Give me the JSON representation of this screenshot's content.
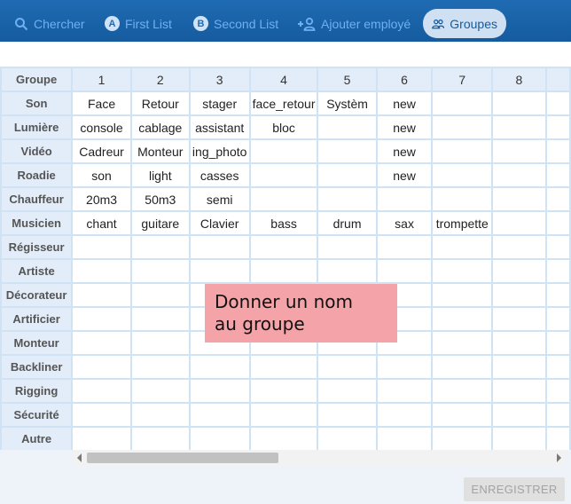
{
  "nav": {
    "chercher": "Chercher",
    "first_list": "First List",
    "first_list_badge": "A",
    "second_list": "Second List",
    "second_list_badge": "B",
    "ajouter": "Ajouter employé",
    "groupes": "Groupes"
  },
  "table": {
    "corner": "Groupe",
    "columns": [
      "1",
      "2",
      "3",
      "4",
      "5",
      "6",
      "7",
      "8"
    ],
    "rows": [
      {
        "label": "Son",
        "cells": [
          "Face",
          "Retour",
          "stager",
          "face_retour",
          "Systèm",
          "new",
          "",
          ""
        ]
      },
      {
        "label": "Lumière",
        "cells": [
          "console",
          "cablage",
          "assistant",
          "bloc",
          "",
          "new",
          "",
          ""
        ]
      },
      {
        "label": "Vidéo",
        "cells": [
          "Cadreur",
          "Monteur",
          "ing_photo",
          "",
          "",
          "new",
          "",
          ""
        ]
      },
      {
        "label": "Roadie",
        "cells": [
          "son",
          "light",
          "casses",
          "",
          "",
          "new",
          "",
          ""
        ]
      },
      {
        "label": "Chauffeur",
        "cells": [
          "20m3",
          "50m3",
          "semi",
          "",
          "",
          "",
          "",
          ""
        ]
      },
      {
        "label": "Musicien",
        "cells": [
          "chant",
          "guitare",
          "Clavier",
          "bass",
          "drum",
          "sax",
          "trompette",
          ""
        ]
      },
      {
        "label": "Régisseur",
        "cells": [
          "",
          "",
          "",
          "",
          "",
          "",
          "",
          ""
        ]
      },
      {
        "label": "Artiste",
        "cells": [
          "",
          "",
          "",
          "",
          "",
          "",
          "",
          ""
        ]
      },
      {
        "label": "Décorateur",
        "cells": [
          "",
          "",
          "",
          "",
          "",
          "",
          "",
          ""
        ]
      },
      {
        "label": "Artificier",
        "cells": [
          "",
          "",
          "",
          "",
          "",
          "",
          "",
          ""
        ]
      },
      {
        "label": "Monteur",
        "cells": [
          "",
          "",
          "",
          "",
          "",
          "",
          "",
          ""
        ]
      },
      {
        "label": "Backliner",
        "cells": [
          "",
          "",
          "",
          "",
          "",
          "",
          "",
          ""
        ]
      },
      {
        "label": "Rigging",
        "cells": [
          "",
          "",
          "",
          "",
          "",
          "",
          "",
          ""
        ]
      },
      {
        "label": "Sécurité",
        "cells": [
          "",
          "",
          "",
          "",
          "",
          "",
          "",
          ""
        ]
      },
      {
        "label": "Autre",
        "cells": [
          "",
          "",
          "",
          "",
          "",
          "",
          "",
          ""
        ]
      }
    ]
  },
  "tooltip": {
    "line1": "Donner un nom",
    "line2": "au groupe"
  },
  "save_label": "ENREGISTRER"
}
